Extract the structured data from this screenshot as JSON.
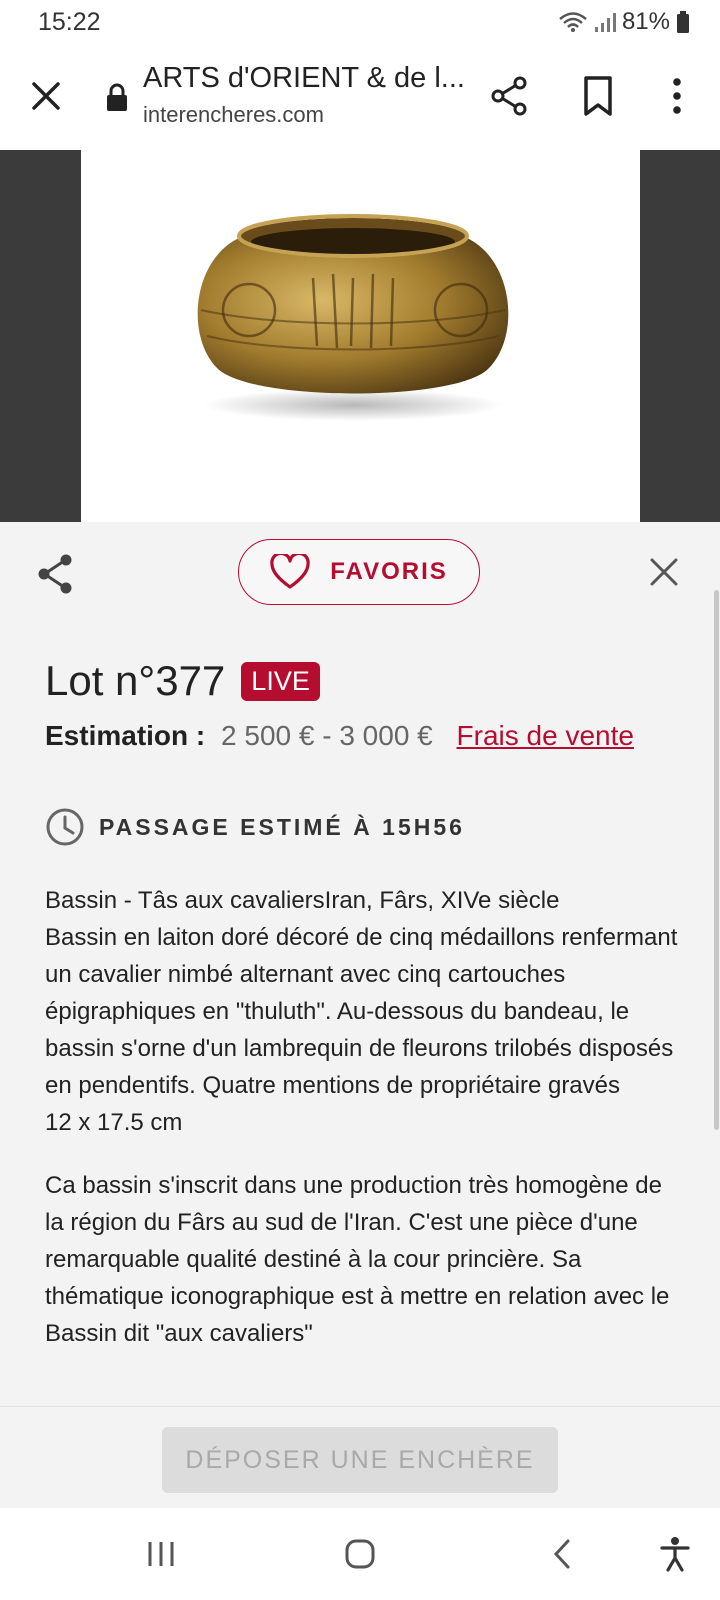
{
  "status_bar": {
    "time": "15:22",
    "battery": "81%"
  },
  "browser": {
    "title": "ARTS d'ORIENT & de l...",
    "url": "interencheres.com",
    "icons": [
      "close-icon",
      "lock-icon",
      "share-icon",
      "bookmark-icon",
      "more-vert-icon"
    ]
  },
  "sheet": {
    "favoris_label": "FAVORIS",
    "lot_title": "Lot n°377",
    "live_badge": "LIVE",
    "estimation_label": "Estimation :",
    "estimation_value": "2 500 € - 3 000 €",
    "frais_link": "Frais de vente",
    "passage": "PASSAGE ESTIMÉ À 15H56",
    "description_1": "Bassin - Tâs aux cavaliersIran, Fârs, XIVe siècle\nBassin en laiton doré décoré de cinq médaillons renfermant un cavalier nimbé alternant avec cinq cartouches épigraphiques en \"thuluth\". Au-dessous du bandeau, le bassin s'orne d'un lambrequin de fleurons trilobés disposés en pendentifs. Quatre mentions de propriétaire gravés\n12 x 17.5 cm",
    "description_2": "Ca bassin s'inscrit dans une production très homogène de la région du Fârs au sud de l'Iran. C'est une pièce d'une remarquable qualité destiné à la cour princière. Sa thématique iconographique est à mettre en relation avec le Bassin dit \"aux cavaliers\""
  },
  "action": {
    "bid_button": "DÉPOSER UNE ENCHÈRE"
  },
  "colors": {
    "accent": "#b50d2f",
    "image_bg": "#3b3b3b",
    "sheet_bg": "#f3f3f3"
  },
  "nav_bar": {
    "icons": [
      "recent-apps-icon",
      "home-icon",
      "back-icon",
      "accessibility-icon"
    ]
  }
}
